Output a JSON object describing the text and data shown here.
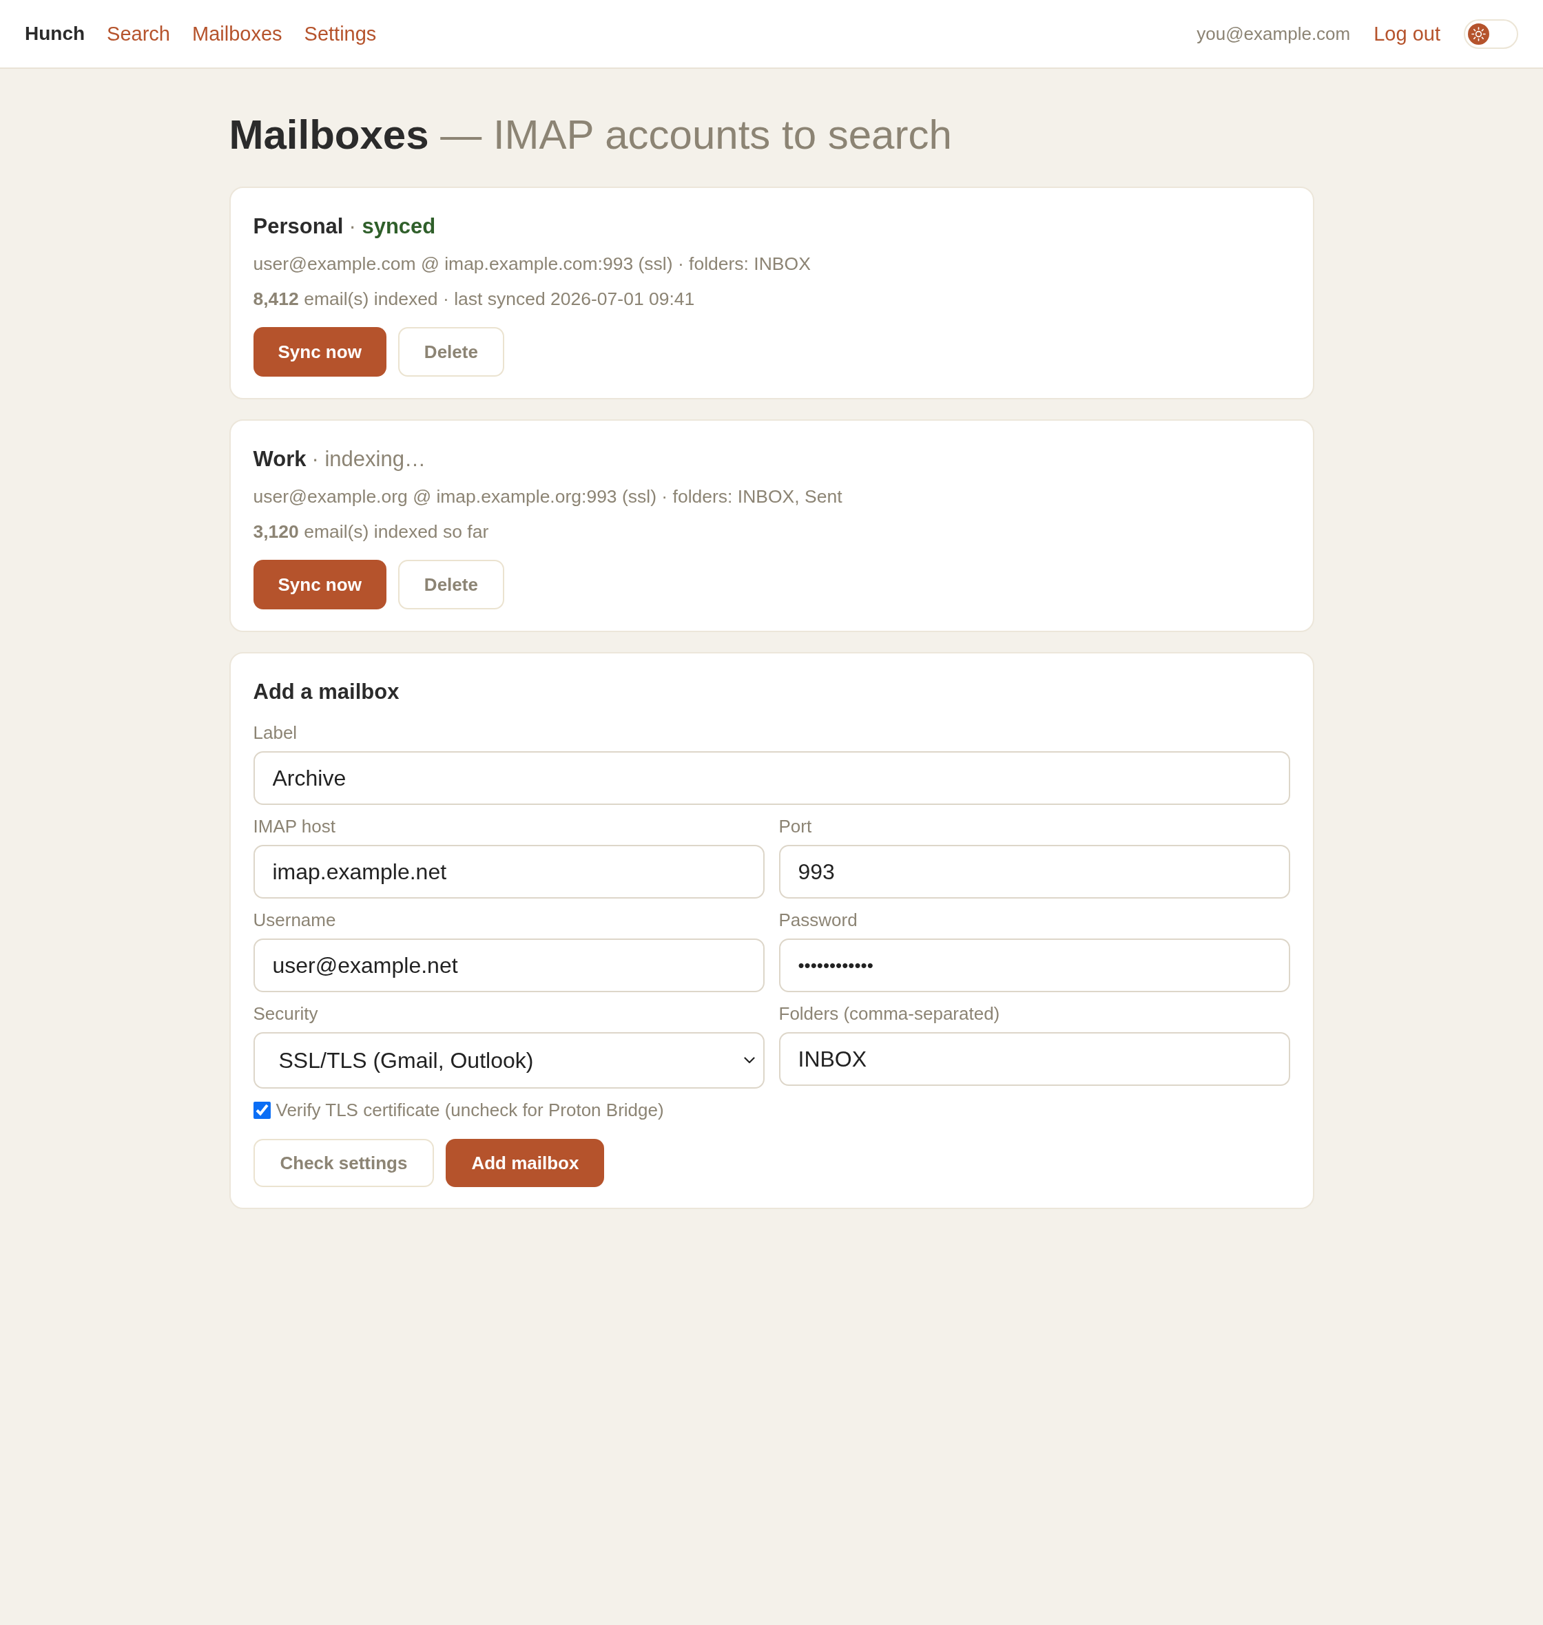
{
  "nav": {
    "brand": "Hunch",
    "links": [
      "Search",
      "Mailboxes",
      "Settings"
    ],
    "user_email": "you@example.com",
    "logout": "Log out",
    "theme_toggle": {
      "on": false
    }
  },
  "page": {
    "title": "**Mailboxes** — IMAP accounts to search"
  },
  "mailboxes": [
    {
      "name": "Personal",
      "status": {
        "separator": "·",
        "label": "synced",
        "kind": "synced"
      },
      "details": "user@example.com @ imap.example.com:993 (ssl) · folders: INBOX",
      "summary": "**8,412** email(s) indexed · last synced 2026-07-01 09:41",
      "buttons": [
        {
          "label": "Sync now",
          "kind": "primary"
        },
        {
          "label": "Delete",
          "kind": "secondary"
        }
      ]
    },
    {
      "name": "Work",
      "status": {
        "separator": "·",
        "label": "indexing…",
        "kind": "indexing"
      },
      "details": "user@example.org @ imap.example.org:993 (ssl) · folders: INBOX, Sent",
      "summary": "**3,120** email(s) indexed so far",
      "buttons": [
        {
          "label": "Sync now",
          "kind": "primary"
        },
        {
          "label": "Delete",
          "kind": "secondary"
        }
      ]
    }
  ],
  "add_form": {
    "title": "Add a mailbox",
    "rows": [
      [
        {
          "label": "Label",
          "kind": "text",
          "value": "Archive"
        }
      ],
      [
        {
          "label": "IMAP host",
          "kind": "text",
          "value": "imap.example.net"
        },
        {
          "label": "Port",
          "kind": "text",
          "value": "993"
        }
      ],
      [
        {
          "label": "Username",
          "kind": "text",
          "value": "user@example.net"
        },
        {
          "label": "Password",
          "kind": "password",
          "value": "••••••••••••"
        }
      ],
      [
        {
          "label": "Security",
          "kind": "select",
          "value": "SSL/TLS (Gmail, Outlook)"
        },
        {
          "label": "Folders (comma-separated)",
          "kind": "text",
          "value": "INBOX"
        }
      ]
    ],
    "checkbox": {
      "label": "Verify TLS certificate (uncheck for Proton Bridge)",
      "checked": true
    },
    "buttons": [
      {
        "label": "Check settings",
        "kind": "secondary"
      },
      {
        "label": "Add mailbox",
        "kind": "primary"
      }
    ]
  }
}
